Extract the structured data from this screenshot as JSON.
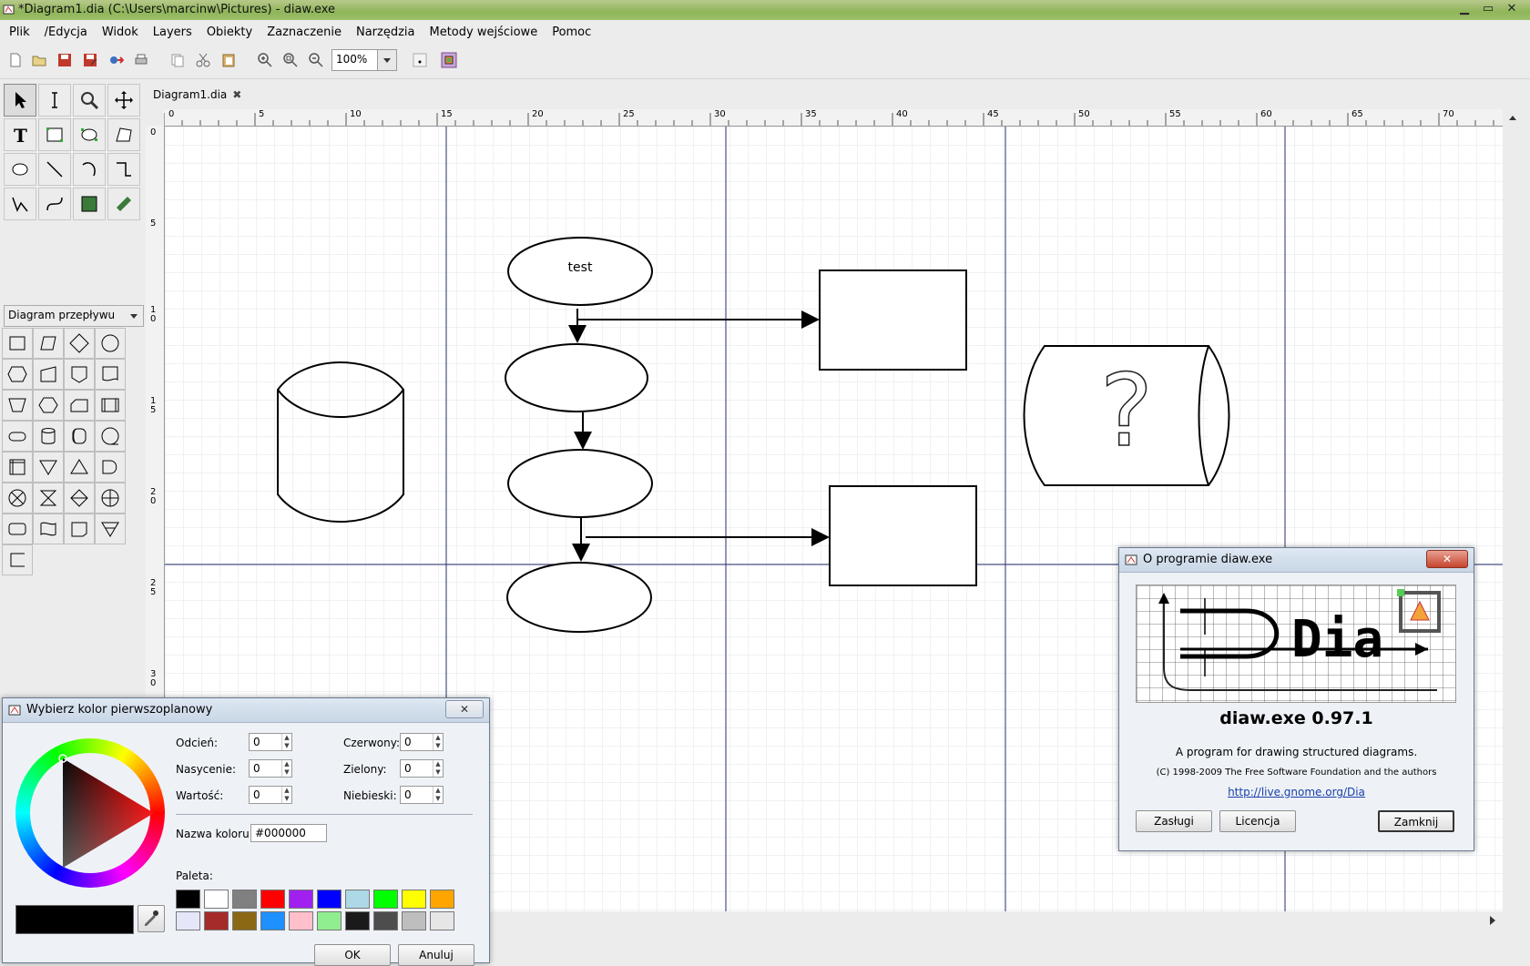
{
  "window": {
    "title": "*Diagram1.dia (C:\\Users\\marcinw\\Pictures) - diaw.exe",
    "minimize": "▁",
    "maximize": "▭",
    "close": "✕"
  },
  "menu": [
    "Plik",
    "/Edycja",
    "Widok",
    "Layers",
    "Obiekty",
    "Zaznaczenie",
    "Narzędzia",
    "Metody wejściowe",
    "Pomoc"
  ],
  "toolbar": {
    "zoom_value": "100%",
    "icons": [
      "new-file-icon",
      "open-file-icon",
      "save-icon",
      "save-as-icon",
      "export-icon",
      "print-icon",
      "copy-icon",
      "cut-icon",
      "paste-icon",
      "zoom-in-icon",
      "zoom-fit-icon",
      "zoom-out-icon"
    ]
  },
  "toolbox": {
    "sheet_name": "Diagram przepływu",
    "tools": [
      "pointer-tool",
      "text-edit-tool",
      "magnify-tool",
      "scroll-tool",
      "text-tool",
      "box-tool",
      "ellipse-tool",
      "polygon-tool",
      "beziergon-tool",
      "line-tool",
      "arc-tool",
      "zigzag-line-tool",
      "polyline-tool",
      "bezier-line-tool",
      "image-tool",
      "outline-tool"
    ]
  },
  "tab": {
    "label": "Diagram1.dia",
    "close": "✖"
  },
  "ruler": {
    "top_ticks": [
      "0",
      "5",
      "10",
      "15",
      "20",
      "25",
      "30",
      "35",
      "40",
      "45",
      "50",
      "55",
      "60",
      "65",
      "70"
    ],
    "left_ticks": [
      "0",
      "5",
      "1\n0",
      "1\n5",
      "2\n0",
      "2\n5",
      "3\n0"
    ]
  },
  "diagram": {
    "ellipse_text": "test"
  },
  "about_dialog": {
    "title": "O programie diaw.exe",
    "close": "✕",
    "app_name": "diaw.exe 0.97.1",
    "description": "A program for drawing structured diagrams.",
    "copyright": "(C) 1998-2009 The Free Software Foundation and the authors",
    "link": "http://live.gnome.org/Dia",
    "btn_credits": "Zasługi",
    "btn_license": "Licencja",
    "btn_close": "Zamknij",
    "logo_text": "Dia"
  },
  "color_dialog": {
    "title": "Wybierz kolor pierwszoplanowy",
    "close": "✕",
    "hue_label": "Odcień:",
    "hue": "0",
    "sat_label": "Nasycenie:",
    "sat": "0",
    "val_label": "Wartość:",
    "val": "0",
    "red_label": "Czerwony:",
    "red": "0",
    "green_label": "Zielony:",
    "green": "0",
    "blue_label": "Niebieski:",
    "blue": "0",
    "name_label": "Nazwa koloru:",
    "name": "#000000",
    "palette_label": "Paleta:",
    "palette": [
      "#000000",
      "#ffffff",
      "#808080",
      "#ff0000",
      "#a020f0",
      "#0000ff",
      "#add8e6",
      "#00ff00",
      "#ffff00",
      "#ffa500",
      "#e6e6fa",
      "#a52a2a",
      "#8b6914",
      "#1e90ff",
      "#ffc0cb",
      "#90ee90",
      "#1a1a1a",
      "#4d4d4d",
      "#bebebe",
      "#e6e6e6"
    ],
    "current_color": "#000000",
    "ok": "OK",
    "cancel": "Anuluj"
  }
}
